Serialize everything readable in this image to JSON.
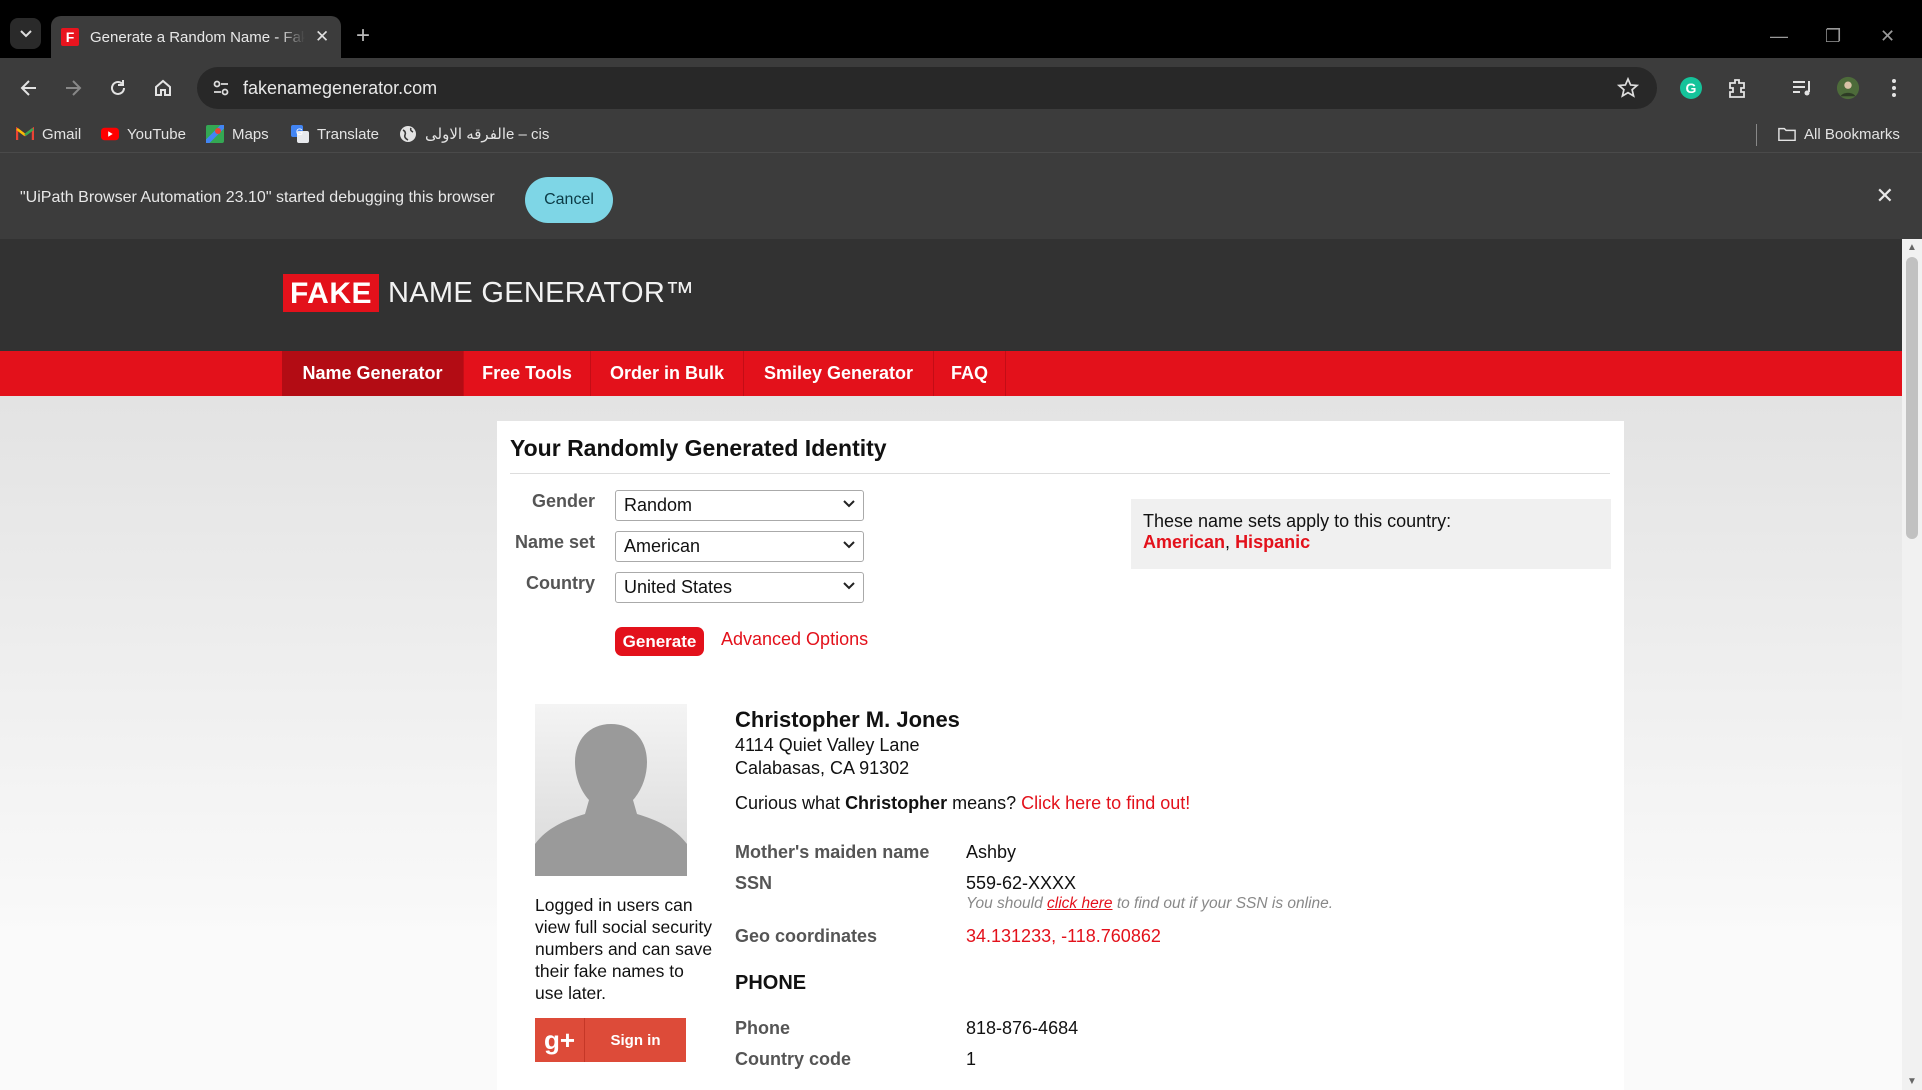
{
  "browser": {
    "tab_title": "Generate a Random Name - Fake Name Generator",
    "tab_favicon_letter": "F",
    "url": "fakenamegenerator.com",
    "bookmarks": [
      {
        "label": "Gmail",
        "icon": "gmail-icon"
      },
      {
        "label": "YouTube",
        "icon": "youtube-icon"
      },
      {
        "label": "Maps",
        "icon": "maps-icon"
      },
      {
        "label": "Translate",
        "icon": "translate-icon"
      },
      {
        "label": "الفرقه الاولىe – cis",
        "icon": "globe-icon"
      }
    ],
    "all_bookmarks": "All Bookmarks",
    "infobar": {
      "message": "\"UiPath Browser Automation 23.10\" started debugging this browser",
      "cancel_label": "Cancel"
    }
  },
  "site": {
    "logo_fake": "FAKE",
    "logo_rest": "NAME GENERATOR™",
    "nav": [
      {
        "label": "Name Generator",
        "active": true
      },
      {
        "label": "Free Tools",
        "active": false
      },
      {
        "label": "Order in Bulk",
        "active": false
      },
      {
        "label": "Smiley Generator",
        "active": false
      },
      {
        "label": "FAQ",
        "active": false
      }
    ]
  },
  "form": {
    "title": "Your Randomly Generated Identity",
    "gender_label": "Gender",
    "gender_value": "Random",
    "nameset_label": "Name set",
    "nameset_value": "American",
    "country_label": "Country",
    "country_value": "United States",
    "generate_label": "Generate",
    "advanced_label": "Advanced Options",
    "namesets_text": "These name sets apply to this country:",
    "namesets": [
      "American",
      "Hispanic"
    ]
  },
  "identity": {
    "name": "Christopher M. Jones",
    "address_line1": "4114 Quiet Valley Lane",
    "address_line2": "Calabasas, CA 91302",
    "curious_prefix": "Curious what",
    "first_name": "Christopher",
    "curious_middle": "means?",
    "curious_link": "Click here to find out!",
    "login_note": "Logged in users can view full social security numbers and can save their fake names to use later.",
    "signin_label": "Sign in",
    "fields": {
      "maiden_label": "Mother's maiden name",
      "maiden_value": "Ashby",
      "ssn_label": "SSN",
      "ssn_value": "559-62-XXXX",
      "ssn_note_prefix": "You should",
      "ssn_note_link": "click here",
      "ssn_note_suffix": "to find out if your SSN is online.",
      "geo_label": "Geo coordinates",
      "geo_value": "34.131233, -118.760862"
    },
    "phone_section": "PHONE",
    "phone_label": "Phone",
    "phone_value": "818-876-4684",
    "country_code_label": "Country code",
    "country_code_value": "1"
  }
}
